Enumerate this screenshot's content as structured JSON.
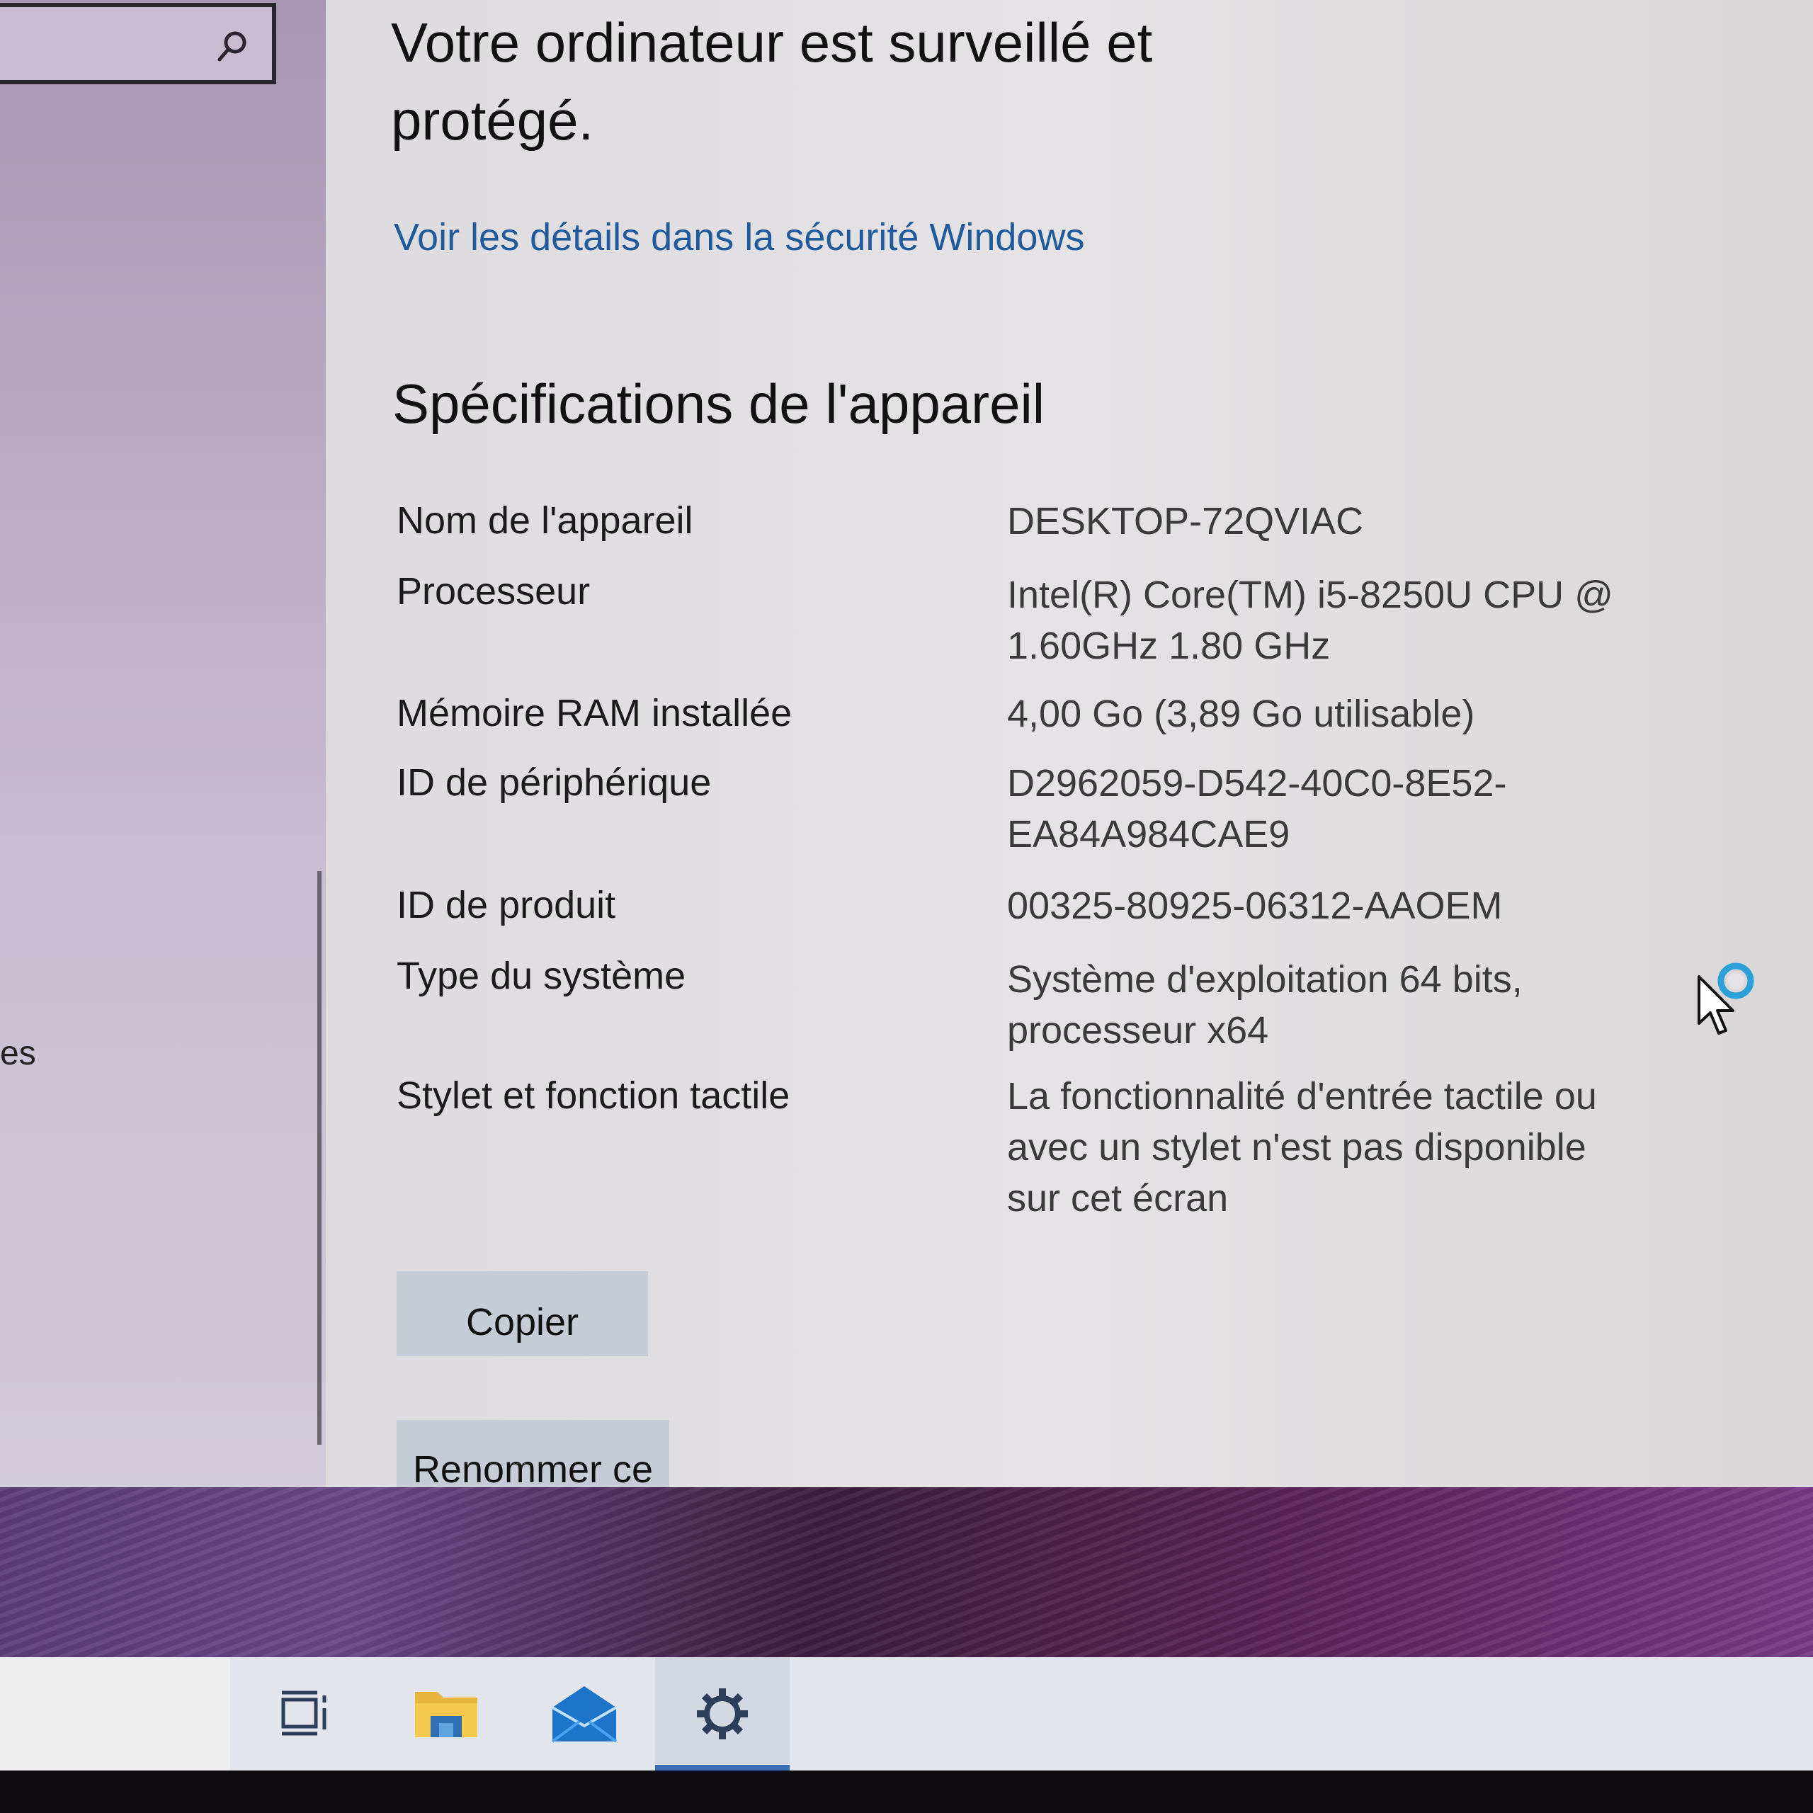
{
  "protection": {
    "status_line1": "Votre ordinateur est surveillé et",
    "status_line2": "protégé.",
    "details_link": "Voir les détails dans la sécurité Windows"
  },
  "specs": {
    "heading": "Spécifications de l'appareil",
    "rows": [
      {
        "label": "Nom de l'appareil",
        "value": [
          "DESKTOP-72QVIAC"
        ]
      },
      {
        "label": "Processeur",
        "value": [
          "Intel(R) Core(TM) i5-8250U CPU @",
          "1.60GHz   1.80 GHz"
        ]
      },
      {
        "label": "Mémoire RAM installée",
        "value": [
          "4,00 Go (3,89 Go utilisable)"
        ]
      },
      {
        "label": "ID de périphérique",
        "value": [
          "D2962059-D542-40C0-8E52-",
          "EA84A984CAE9"
        ]
      },
      {
        "label": "ID de produit",
        "value": [
          "00325-80925-06312-AAOEM"
        ]
      },
      {
        "label": "Type du système",
        "value": [
          "Système d'exploitation 64 bits,",
          "processeur x64"
        ]
      },
      {
        "label": "Stylet et fonction tactile",
        "value": [
          "La fonctionnalité d'entrée tactile ou",
          "avec un stylet n'est pas disponible",
          "sur cet écran"
        ]
      }
    ],
    "copy_button": "Copier",
    "rename_button": "Renommer ce PC"
  },
  "left_pane": {
    "partial_text": "es"
  },
  "taskbar": {
    "icons": [
      "task-view-icon",
      "file-explorer-icon",
      "mail-icon",
      "settings-icon"
    ],
    "active": "settings-icon"
  },
  "colors": {
    "link": "#1f5a9c",
    "button_bg": "#c5ccd6",
    "taskbar_bg": "#e2e5eb",
    "busy_ring": "#2a9fd8"
  }
}
